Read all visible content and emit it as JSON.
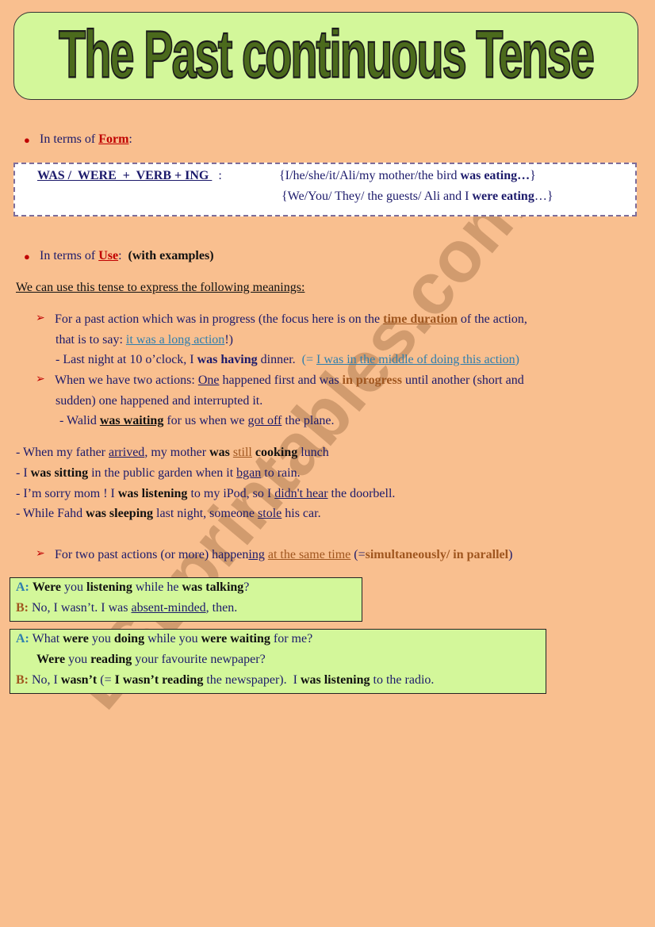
{
  "title": "The Past continuous Tense",
  "watermark": "ESLprintables.com",
  "colors": {
    "background": "#f9bf8f",
    "title_box": "#d3f79a",
    "title_text": "#4b6a1c",
    "text": "#1c1a6b",
    "red": "#c00000",
    "brown": "#a0561f",
    "teal": "#2f7fae"
  },
  "icons": {
    "bullet": "bullet-icon",
    "arrow": "arrow-bullet-icon"
  },
  "lines": {
    "form_heading": [
      {
        "t": "In terms of ",
        "s": ""
      },
      {
        "t": "Form",
        "s": "red b u"
      },
      {
        "t": ":",
        "s": ""
      }
    ],
    "form_rule": [
      {
        "t": "WAS /  WERE  +  VERB + ING ",
        "s": "b u"
      },
      {
        "t": "  :",
        "s": ""
      }
    ],
    "form_sing": [
      {
        "t": "{I/he/she/it/Ali/my mother/the bird ",
        "s": ""
      },
      {
        "t": "was eating…",
        "s": "b"
      },
      {
        "t": "}",
        "s": ""
      }
    ],
    "form_plur": [
      {
        "t": "{We/You/ They/ the guests/ Ali and I ",
        "s": ""
      },
      {
        "t": "were eating",
        "s": "b"
      },
      {
        "t": "…}",
        "s": ""
      }
    ],
    "use_heading": [
      {
        "t": "In terms of ",
        "s": ""
      },
      {
        "t": "Use",
        "s": "red b u"
      },
      {
        "t": ":  ",
        "s": ""
      },
      {
        "t": "(with examples)",
        "s": "b bk"
      }
    ],
    "intro": [
      {
        "t": "We can use this tense to express the following meanings:",
        "s": "u bk"
      }
    ],
    "use1a": [
      {
        "t": "For a past action which was in progress (the focus here is on the ",
        "s": ""
      },
      {
        "t": "time duration",
        "s": "brown b u"
      },
      {
        "t": " of the action,",
        "s": ""
      }
    ],
    "use1b": [
      {
        "t": "that is to say: ",
        "s": ""
      },
      {
        "t": "it was a long action",
        "s": "teal u"
      },
      {
        "t": "!)",
        "s": ""
      }
    ],
    "use1c": [
      {
        "t": "- Last night at 10 o’clock, I ",
        "s": ""
      },
      {
        "t": "was having",
        "s": "b"
      },
      {
        "t": " dinner.  ",
        "s": ""
      },
      {
        "t": "(= ",
        "s": "teal"
      },
      {
        "t": "I was in the middle of doing this action",
        "s": "teal u"
      },
      {
        "t": ")",
        "s": "teal"
      }
    ],
    "use2a": [
      {
        "t": "When we have two actions: ",
        "s": ""
      },
      {
        "t": "One",
        "s": "u"
      },
      {
        "t": " happened first and was ",
        "s": ""
      },
      {
        "t": "in progress",
        "s": "brown b"
      },
      {
        "t": " until another (short and",
        "s": ""
      }
    ],
    "use2b": [
      {
        "t": "sudden) one happened and interrupted it.",
        "s": ""
      }
    ],
    "use2c": [
      {
        "t": "- Walid ",
        "s": ""
      },
      {
        "t": "was waiting",
        "s": "b bk u"
      },
      {
        "t": " for us when we ",
        "s": ""
      },
      {
        "t": "got off",
        "s": "u"
      },
      {
        "t": " the plane.",
        "s": ""
      }
    ],
    "ex1": [
      {
        "t": "- When my father ",
        "s": ""
      },
      {
        "t": "arrived",
        "s": "u"
      },
      {
        "t": ", my mother ",
        "s": ""
      },
      {
        "t": "was",
        "s": "b bk"
      },
      {
        "t": " ",
        "s": ""
      },
      {
        "t": "still",
        "s": "brown u"
      },
      {
        "t": " ",
        "s": ""
      },
      {
        "t": "cooking",
        "s": "b bk"
      },
      {
        "t": " lunch",
        "s": ""
      }
    ],
    "ex2": [
      {
        "t": "- I ",
        "s": ""
      },
      {
        "t": "was sitting",
        "s": "b bk"
      },
      {
        "t": " in the public garden when it ",
        "s": ""
      },
      {
        "t": "bgan",
        "s": "u"
      },
      {
        "t": " to rain.",
        "s": ""
      }
    ],
    "ex3": [
      {
        "t": "- I’m sorry mom ! I ",
        "s": ""
      },
      {
        "t": "was listening",
        "s": "b bk"
      },
      {
        "t": " to my iPod, so I ",
        "s": ""
      },
      {
        "t": "didn't hear",
        "s": "u"
      },
      {
        "t": " the doorbell.",
        "s": ""
      }
    ],
    "ex4": [
      {
        "t": "- While Fahd ",
        "s": ""
      },
      {
        "t": "was sleeping",
        "s": "b bk"
      },
      {
        "t": " last night, someone ",
        "s": ""
      },
      {
        "t": "stole",
        "s": "u"
      },
      {
        "t": " his car.",
        "s": ""
      }
    ],
    "use3": [
      {
        "t": "For two past actions (or more) happen",
        "s": ""
      },
      {
        "t": "ing",
        "s": "u"
      },
      {
        "t": " ",
        "s": ""
      },
      {
        "t": "at the same time",
        "s": "brown u"
      },
      {
        "t": " (=",
        "s": ""
      },
      {
        "t": "simultaneously/ in parallel",
        "s": "brown b"
      },
      {
        "t": ")",
        "s": ""
      }
    ],
    "d1a": [
      {
        "t": "A:",
        "s": "teal b"
      },
      {
        "t": " ",
        "s": ""
      },
      {
        "t": "Were",
        "s": "b bk"
      },
      {
        "t": " you ",
        "s": ""
      },
      {
        "t": "listening",
        "s": "b bk"
      },
      {
        "t": " while he ",
        "s": ""
      },
      {
        "t": "was talking",
        "s": "b bk"
      },
      {
        "t": "?",
        "s": ""
      }
    ],
    "d1b": [
      {
        "t": "B:",
        "s": "brown b"
      },
      {
        "t": " No, I wasn’t. I was ",
        "s": ""
      },
      {
        "t": "absent-minded",
        "s": "u"
      },
      {
        "t": ", then.",
        "s": ""
      }
    ],
    "d2a": [
      {
        "t": "A:",
        "s": "teal b"
      },
      {
        "t": " What ",
        "s": ""
      },
      {
        "t": "were",
        "s": "b bk"
      },
      {
        "t": " you ",
        "s": ""
      },
      {
        "t": "doing",
        "s": "b bk"
      },
      {
        "t": " while you ",
        "s": ""
      },
      {
        "t": "were waiting",
        "s": "b bk"
      },
      {
        "t": " for me?",
        "s": ""
      }
    ],
    "d2b": [
      {
        "t": "Were",
        "s": "b bk"
      },
      {
        "t": " you ",
        "s": ""
      },
      {
        "t": "reading",
        "s": "b bk"
      },
      {
        "t": " your favourite newpaper?",
        "s": ""
      }
    ],
    "d2c": [
      {
        "t": "B:",
        "s": "brown b"
      },
      {
        "t": " No, I ",
        "s": ""
      },
      {
        "t": "wasn’t",
        "s": "b bk"
      },
      {
        "t": " (= ",
        "s": ""
      },
      {
        "t": "I wasn’t reading",
        "s": "b bk"
      },
      {
        "t": " the newspaper).  I ",
        "s": ""
      },
      {
        "t": "was listening",
        "s": "b bk"
      },
      {
        "t": " to the radio.",
        "s": ""
      }
    ]
  }
}
